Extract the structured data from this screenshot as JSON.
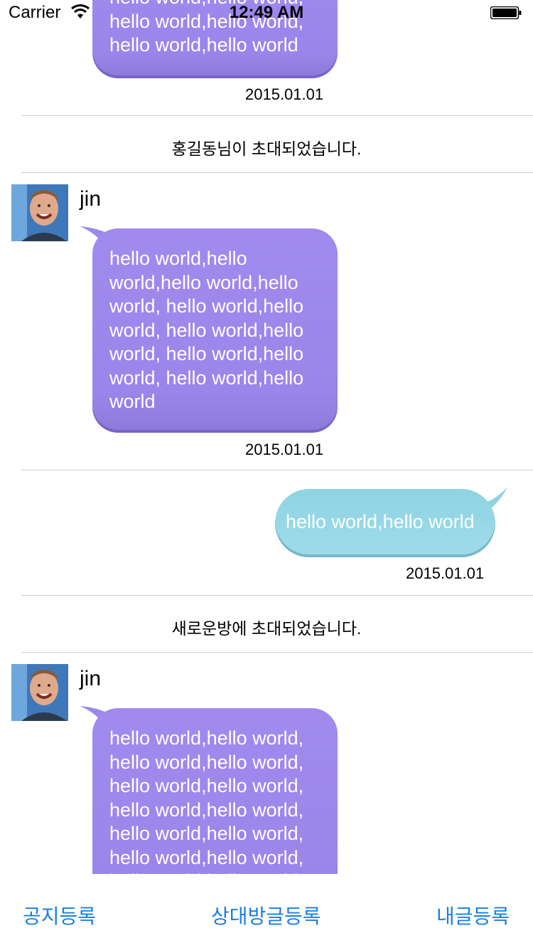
{
  "status_bar": {
    "carrier": "Carrier",
    "time": "12:49 AM",
    "wifi_icon": "wifi-icon",
    "battery_icon": "battery-icon"
  },
  "colors": {
    "received_bubble": "#9c88ec",
    "sent_bubble": "#94d7e6",
    "toolbar_link": "#1a7fe0",
    "divider": "#cfcfcf"
  },
  "messages": {
    "m1": {
      "text": "hello world,hello world,\nhello world,hello world,\nhello world,hello world",
      "timestamp": "2015.01.01"
    },
    "notice1": "홍길동님이 초대되었습니다.",
    "m2": {
      "sender": "jin",
      "avatar": "avatar-photo",
      "text": "hello world,hello\nworld,hello world,hello\nworld, hello world,hello\nworld, hello world,hello\nworld, hello world,hello\nworld, hello world,hello\nworld",
      "timestamp": "2015.01.01"
    },
    "m3": {
      "text": "hello world,hello world",
      "timestamp": "2015.01.01"
    },
    "notice2": "새로운방에 초대되었습니다.",
    "m4": {
      "sender": "jin",
      "avatar": "avatar-photo",
      "text": "hello world,hello world,\nhello world,hello world,\nhello world,hello world,\nhello world,hello world,\nhello world,hello world,\nhello world,hello world,\nhello world,hello world,"
    }
  },
  "toolbar": {
    "notice_button": "공지등록",
    "other_post_button": "상대방글등록",
    "my_post_button": "내글등록"
  }
}
